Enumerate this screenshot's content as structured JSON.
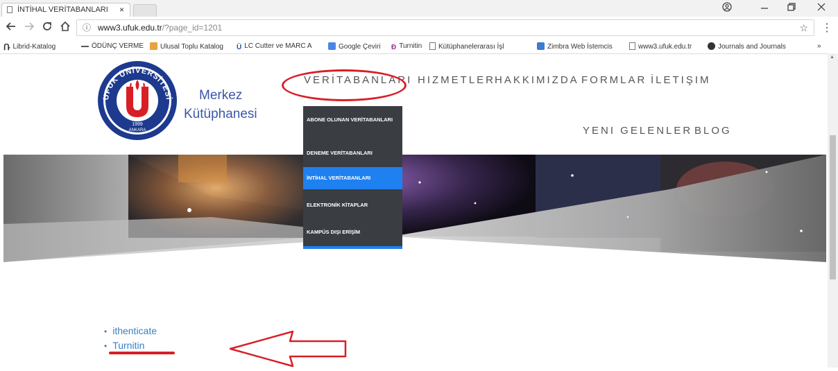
{
  "browser": {
    "tab_title": "İNTİHAL VERİTABANLARI",
    "tab_close": "×",
    "url_host": "www3.ufuk.edu.tr",
    "url_path": "/?page_id=1201",
    "bookmarks": [
      {
        "label": "Librid-Katalog",
        "icon": "librid-icon"
      },
      {
        "label": "ÖDÜNÇ VERME",
        "icon": "loan-icon"
      },
      {
        "label": "Ulusal Toplu Katalog",
        "icon": "catalog-icon"
      },
      {
        "label": "LC Cutter ve MARC A",
        "icon": "u-icon"
      },
      {
        "label": "Google Çeviri",
        "icon": "translate-icon"
      },
      {
        "label": "Turnitin",
        "icon": "turnitin-icon"
      },
      {
        "label": "Kütüphanelerarası İşl",
        "icon": "page-icon"
      },
      {
        "label": "Zimbra Web İstemcis",
        "icon": "zimbra-icon"
      },
      {
        "label": "www3.ufuk.edu.tr",
        "icon": "page-icon"
      },
      {
        "label": "Journals and Journals",
        "icon": "globe-icon"
      }
    ],
    "more_bookmarks": "»"
  },
  "site": {
    "name_line1": "Merkez",
    "name_line2": "Kütüphanesi",
    "logo_text_top": "UFUK ÜNİVERSİTESİ",
    "logo_year": "1999",
    "logo_city": "ANKARA",
    "nav": [
      "VERİTABANLARI",
      "HIZMETLER",
      "HAKKIMIZDA",
      "FORMLAR",
      "İLETIŞIM"
    ],
    "subnav": [
      "YENI GELENLER",
      "BLOG"
    ],
    "dropdown": [
      {
        "label": "ABONE OLUNAN VERİTABANLARI",
        "active": false
      },
      {
        "label": "DENEME VERİTABANLARI",
        "active": false
      },
      {
        "label": "İNTİHAL VERİTABANLARI",
        "active": true
      },
      {
        "label": "ELEKTRONİK KİTAPLAR",
        "active": false
      },
      {
        "label": "KAMPÜS DIŞI ERİŞİM",
        "active": false
      }
    ],
    "links": [
      "ithenticate",
      "Turnitin"
    ]
  },
  "colors": {
    "accent": "#1f80f0",
    "dropdown_bg": "#3a3d42",
    "annotation": "#d81f26",
    "brand": "#3b56a8",
    "link": "#3a7fc4"
  }
}
